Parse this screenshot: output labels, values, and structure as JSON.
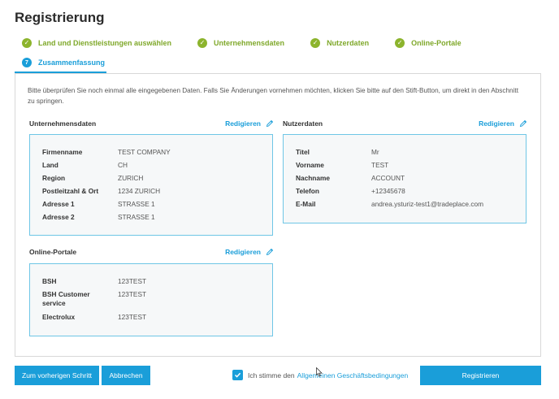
{
  "page": {
    "title": "Registrierung"
  },
  "steps": [
    {
      "label": "Land und Dienstleistungen auswählen",
      "status": "done"
    },
    {
      "label": "Unternehmensdaten",
      "status": "done"
    },
    {
      "label": "Nutzerdaten",
      "status": "done"
    },
    {
      "label": "Online-Portale",
      "status": "done"
    },
    {
      "label": "Zusammenfassung",
      "status": "active",
      "number": "7"
    }
  ],
  "intro": "Bitte überprüfen Sie noch einmal alle eingegebenen Daten. Falls Sie Änderungen vornehmen möchten, klicken Sie bitte auf den Stift-Button, um direkt in den Abschnitt zu springen.",
  "edit_label": "Redigieren",
  "company": {
    "title": "Unternehmensdaten",
    "rows": [
      {
        "key": "Firmenname",
        "value": "TEST COMPANY"
      },
      {
        "key": "Land",
        "value": "CH"
      },
      {
        "key": "Region",
        "value": "ZURICH"
      },
      {
        "key": "Postleitzahl & Ort",
        "value": "1234 ZURICH"
      },
      {
        "key": "Adresse 1",
        "value": "STRASSE 1"
      },
      {
        "key": "Adresse 2",
        "value": "STRASSE 1"
      }
    ]
  },
  "user": {
    "title": "Nutzerdaten",
    "rows": [
      {
        "key": "Titel",
        "value": "Mr"
      },
      {
        "key": "Vorname",
        "value": "TEST"
      },
      {
        "key": "Nachname",
        "value": "ACCOUNT"
      },
      {
        "key": "Telefon",
        "value": "+12345678"
      },
      {
        "key": "E-Mail",
        "value": "andrea.ysturiz-test1@tradeplace.com"
      }
    ]
  },
  "portals": {
    "title": "Online-Portale",
    "rows": [
      {
        "key": "BSH",
        "value": "123TEST"
      },
      {
        "key": "BSH Customer service",
        "value": "123TEST"
      },
      {
        "key": "Electrolux",
        "value": "123TEST"
      }
    ]
  },
  "footer": {
    "back_label": "Zum vorherigen Schritt",
    "cancel_label": "Abbrechen",
    "terms_prefix": "Ich stimme den",
    "terms_link": "Allgemeinen Geschäftsbedingungen",
    "terms_checked": true,
    "submit_label": "Registrieren"
  },
  "colors": {
    "accent": "#1a9ed9",
    "success": "#8cb42d",
    "card_border": "#6fc6e6"
  }
}
